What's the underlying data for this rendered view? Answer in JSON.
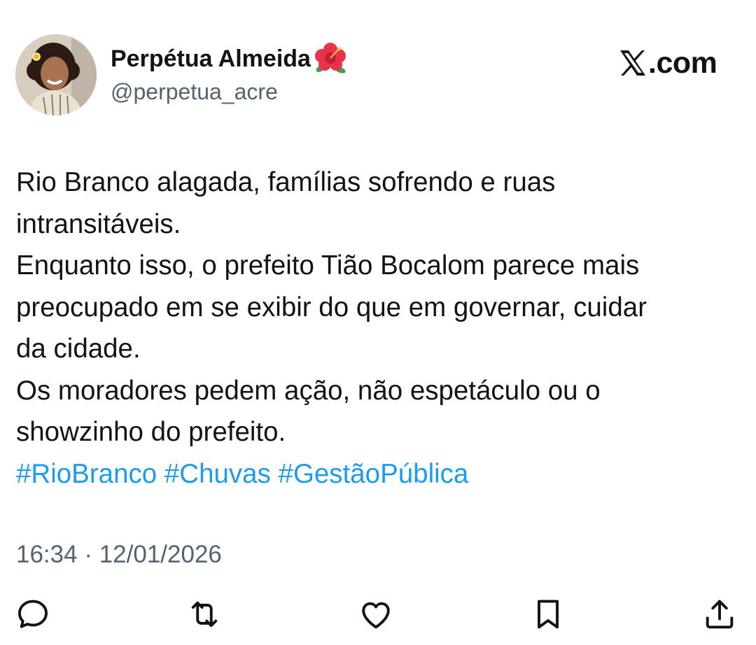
{
  "author": {
    "display_name": "Perpétua Almeida",
    "emoji_icon": "hibiscus-icon",
    "handle": "@perpetua_acre",
    "avatar_icon": "avatar-photo"
  },
  "brand": {
    "logo_icon": "x-logo-icon",
    "text": ".com"
  },
  "tweet": {
    "lines": [
      "Rio Branco alagada, famílias sofrendo e ruas",
      "intransitáveis.",
      "Enquanto isso, o prefeito Tião Bocalom parece mais",
      "preocupado em se exibir do que em governar, cuidar",
      "da cidade.",
      "Os moradores pedem ação, não espetáculo ou o",
      "showzinho do prefeito."
    ],
    "hashtags": [
      "#RioBranco",
      "#Chuvas",
      "#GestãoPública"
    ]
  },
  "timestamp": {
    "time": "16:34",
    "separator": " · ",
    "date": "12/01/2026"
  },
  "actions": [
    {
      "icon": "reply-icon"
    },
    {
      "icon": "retweet-icon"
    },
    {
      "icon": "like-icon"
    },
    {
      "icon": "bookmark-icon"
    },
    {
      "icon": "share-icon"
    }
  ],
  "colors": {
    "text": "#0f1419",
    "secondary": "#536471",
    "link": "#1d9bf0",
    "action_icon": "#536471"
  }
}
